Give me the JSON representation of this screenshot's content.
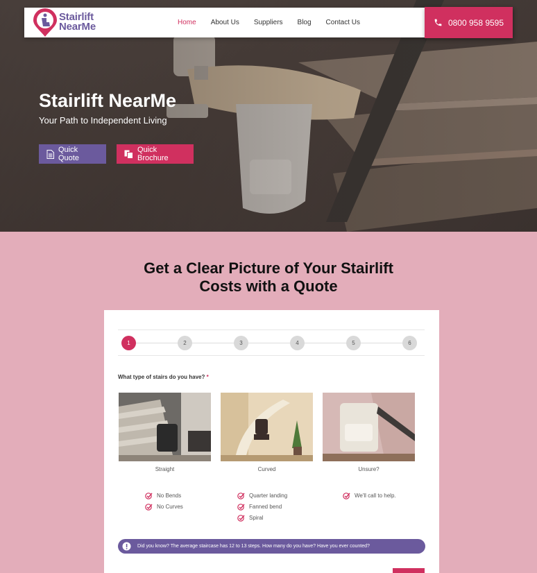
{
  "brand": {
    "name_line1": "Stairlift",
    "name_line2": "NearMe",
    "pink": "#d0305f",
    "purple": "#6b5a9d"
  },
  "nav": {
    "items": [
      "Home",
      "About Us",
      "Suppliers",
      "Blog",
      "Contact Us"
    ],
    "active": "Home"
  },
  "phone": {
    "number": "0800 958 9595",
    "icon": "phone-icon"
  },
  "hero": {
    "title": "Stairlift NearMe",
    "subtitle": "Your Path to Independent Living",
    "quote_button": "Quick Quote",
    "brochure_button": "Quick Brochure"
  },
  "quote": {
    "heading_line1": "Get a Clear Picture of Your Stairlift",
    "heading_line2": "Costs with a Quote",
    "steps": [
      "1",
      "2",
      "3",
      "4",
      "5",
      "6"
    ],
    "current_step": "1",
    "question": "What type of stairs do you have?",
    "required_mark": "*",
    "options": [
      {
        "label": "Straight",
        "features": [
          "No Bends",
          "No Curves"
        ]
      },
      {
        "label": "Curved",
        "features": [
          "Quarter landing",
          "Fanned bend",
          "Spiral"
        ]
      },
      {
        "label": "Unsure?",
        "features": [
          "We'll call to help."
        ]
      }
    ],
    "tip": "Did you know? The average staircase has 12 to 13 steps. How many do you have? Have you ever counted?"
  }
}
